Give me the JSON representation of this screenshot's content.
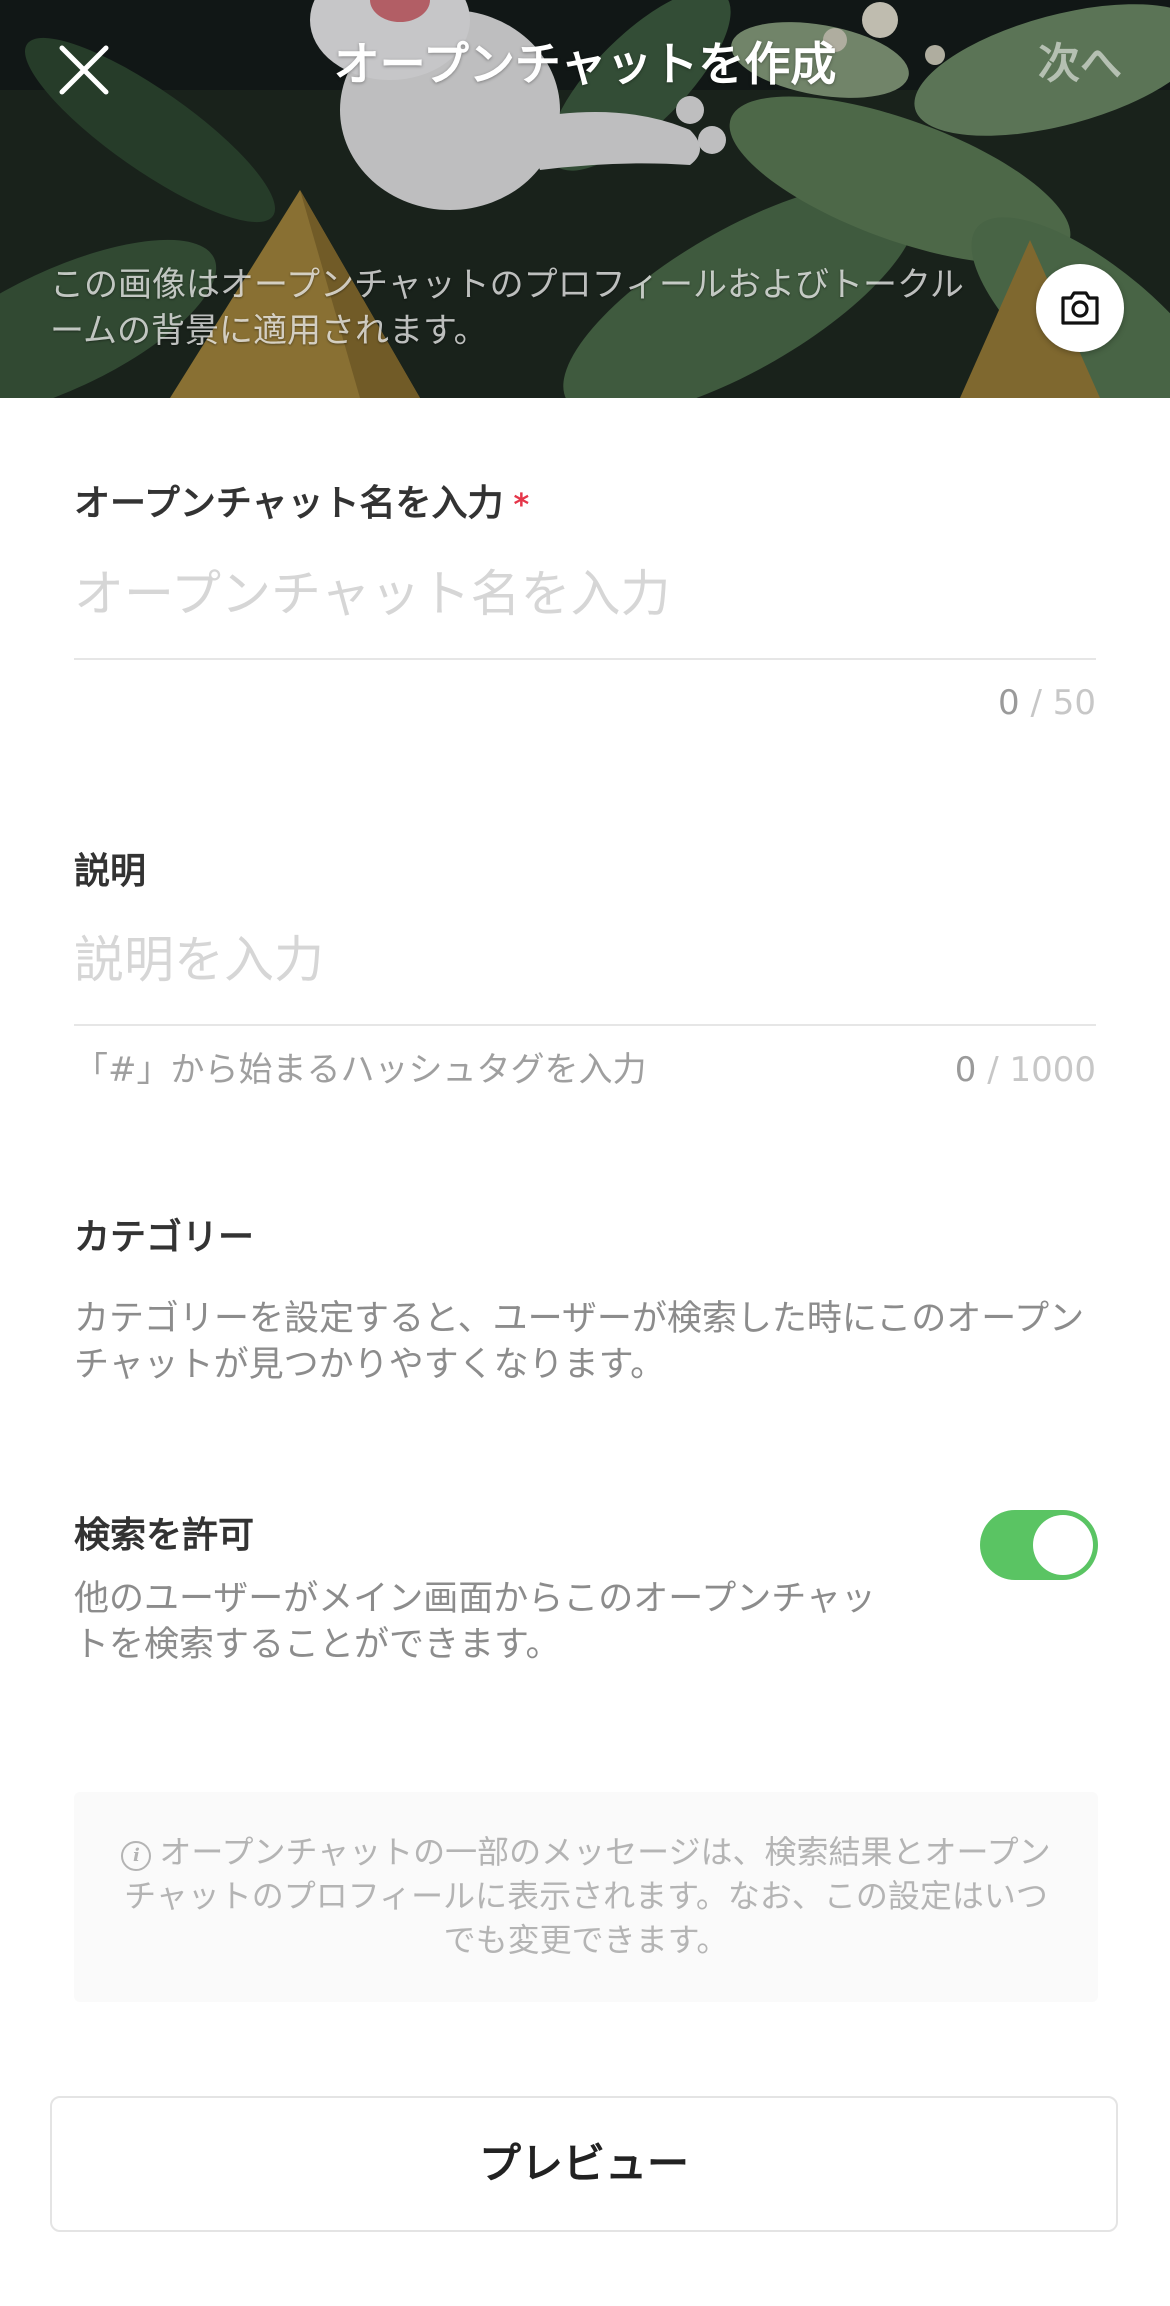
{
  "header": {
    "title": "オープンチャットを作成",
    "next_label": "次へ",
    "close_icon": "close-icon",
    "cover_caption": "この画像はオープンチャットのプロフィールおよびトークルームの背景に適用されます。",
    "camera_icon": "camera-icon"
  },
  "name_field": {
    "label": "オープンチャット名を入力",
    "required_mark": "*",
    "placeholder": "オープンチャット名を入力",
    "value": "",
    "count_current": "0",
    "count_max": " / 50"
  },
  "description_field": {
    "label": "説明",
    "placeholder": "説明を入力",
    "value": "",
    "hint": "「#」から始まるハッシュタグを入力",
    "count_current": "0",
    "count_max": " / 1000"
  },
  "category": {
    "label": "カテゴリー",
    "description": "カテゴリーを設定すると、ユーザーが検索した時にこのオープンチャットが見つかりやすくなります。"
  },
  "search_permission": {
    "label": "検索を許可",
    "description": "他のユーザーがメイン画面からこのオープンチャットを検索することができます。",
    "enabled": true
  },
  "info_notice": {
    "icon": "info-icon",
    "icon_glyph": "i",
    "text": "オープンチャットの一部のメッセージは、検索結果とオープンチャットのプロフィールに表示されます。なお、この設定はいつでも変更できます。"
  },
  "preview_button": {
    "label": "プレビュー"
  },
  "colors": {
    "toggle_on": "#5ac463",
    "required": "#e5364a"
  }
}
